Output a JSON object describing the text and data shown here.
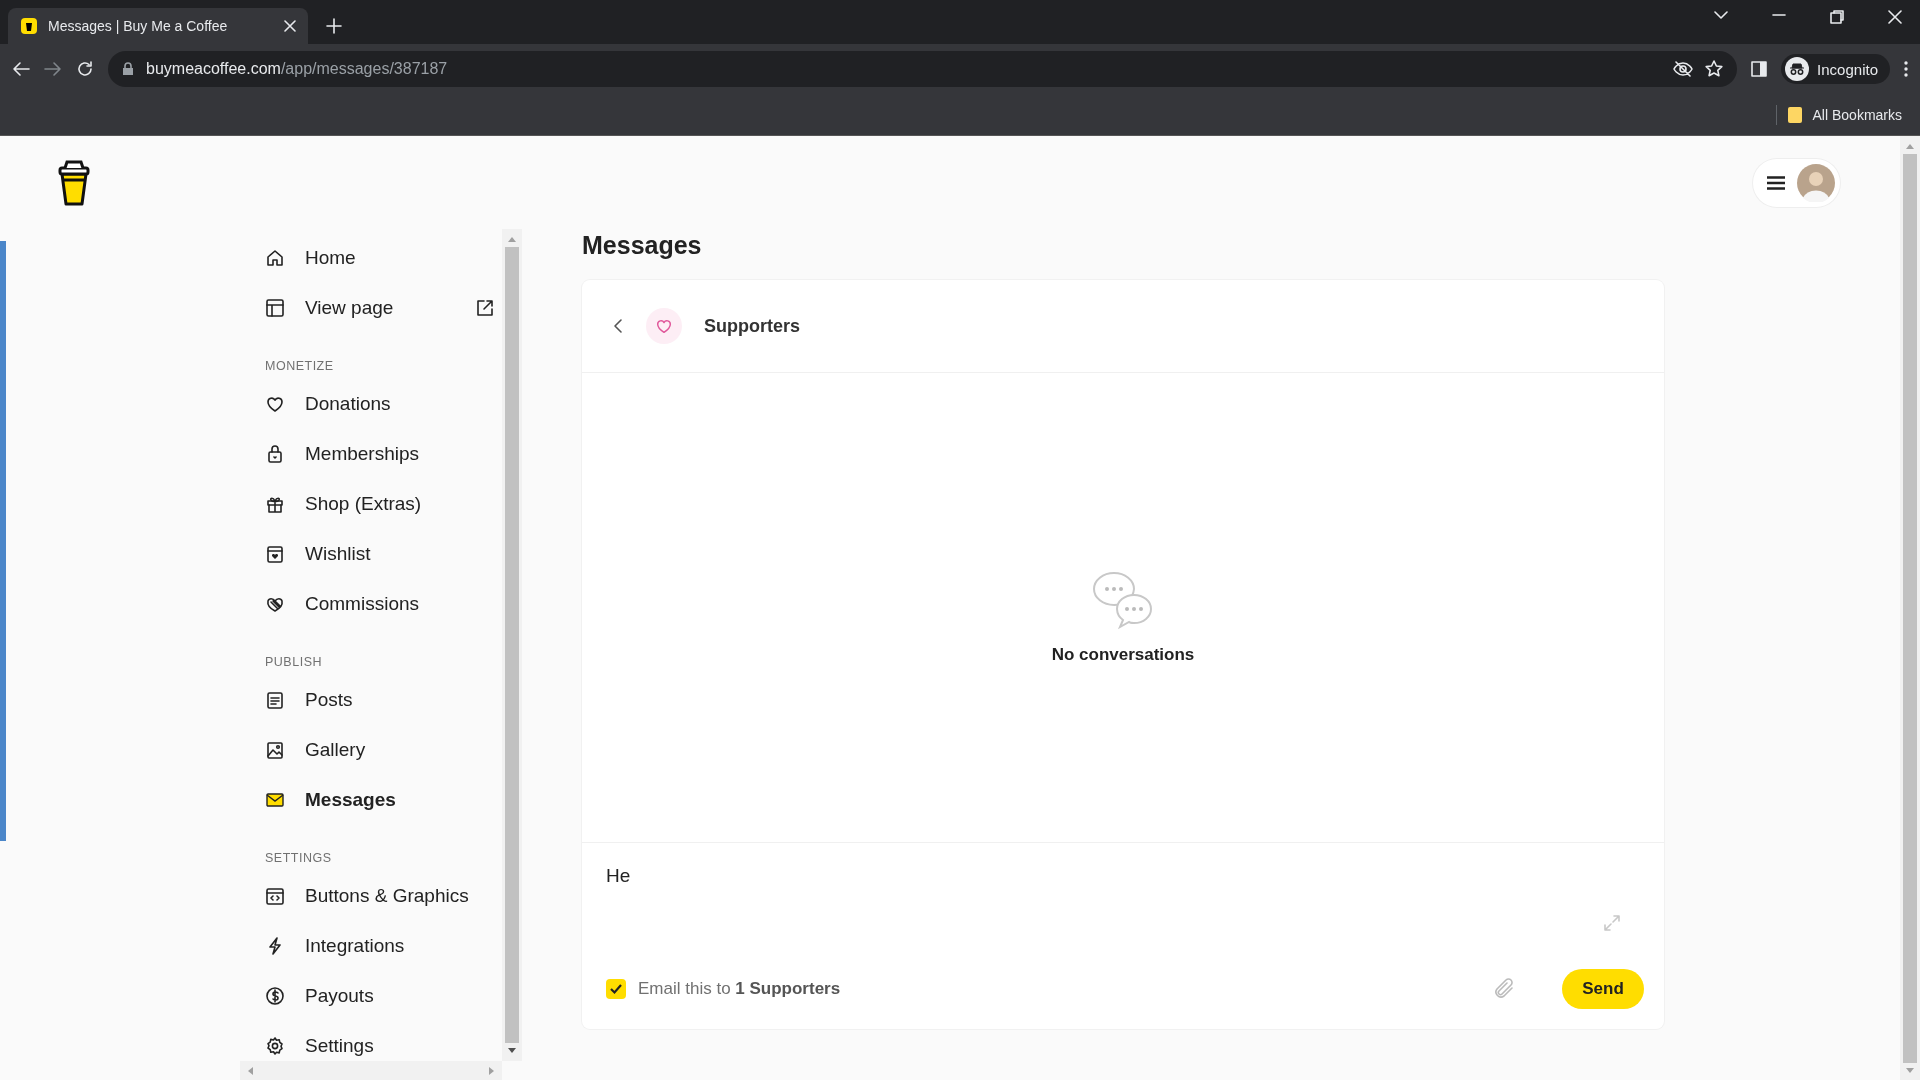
{
  "browser": {
    "tab_title": "Messages | Buy Me a Coffee",
    "url_domain": "buymeacoffee.com",
    "url_path": "/app/messages/387187",
    "profile": "Incognito",
    "bookmarks_label": "All Bookmarks"
  },
  "sidebar": {
    "sections": [
      {
        "items": [
          {
            "label": "Home",
            "selected": false
          },
          {
            "label": "View page",
            "selected": false
          }
        ]
      },
      {
        "heading": "MONETIZE",
        "items": [
          {
            "label": "Donations",
            "selected": false
          },
          {
            "label": "Memberships",
            "selected": false
          },
          {
            "label": "Shop (Extras)",
            "selected": false
          },
          {
            "label": "Wishlist",
            "selected": false
          },
          {
            "label": "Commissions",
            "selected": false
          }
        ]
      },
      {
        "heading": "PUBLISH",
        "items": [
          {
            "label": "Posts",
            "selected": false
          },
          {
            "label": "Gallery",
            "selected": false
          },
          {
            "label": "Messages",
            "selected": true
          }
        ]
      },
      {
        "heading": "SETTINGS",
        "items": [
          {
            "label": "Buttons & Graphics",
            "selected": false
          },
          {
            "label": "Integrations",
            "selected": false
          },
          {
            "label": "Payouts",
            "selected": false
          },
          {
            "label": "Settings",
            "selected": false
          }
        ]
      }
    ]
  },
  "page": {
    "title": "Messages",
    "conversation": {
      "title": "Supporters"
    },
    "empty_text": "No conversations",
    "composer": {
      "value": "He",
      "email_checked": true,
      "email_text": "Email this to **1 Supporters**",
      "send_label": "Send"
    }
  }
}
